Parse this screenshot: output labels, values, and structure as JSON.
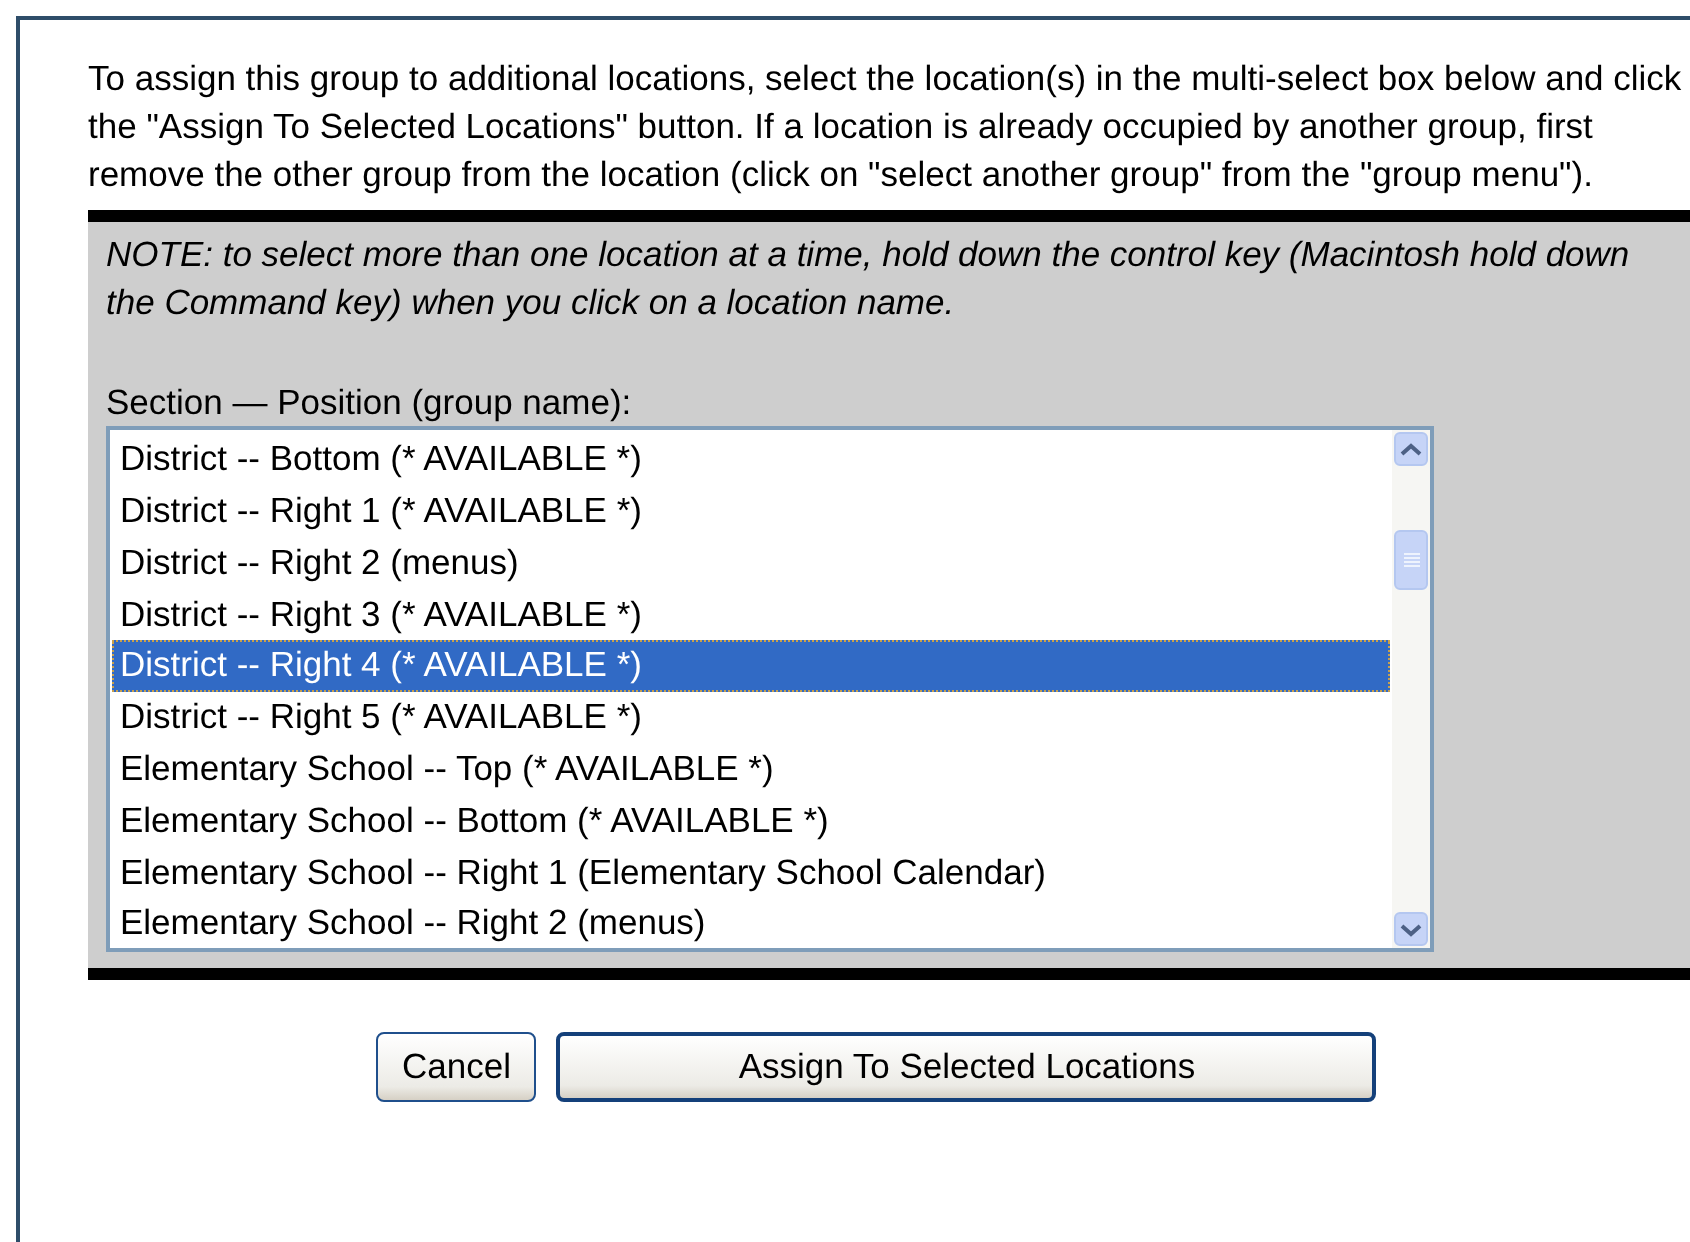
{
  "instructions": "To assign this group to additional locations, select the location(s) in the multi-select box below and click the \"Assign To Selected Locations\" button. If a location is already occupied by another group, first remove the other group from the location (click on \"select another group\" from the \"group menu\").",
  "note": "NOTE: to select more than one location at a time, hold down the control key (Macintosh hold down the Command key) when you click on a location name.",
  "list_label": "Section — Position (group name):",
  "locations": [
    {
      "label": "District -- Bottom (* AVAILABLE *)",
      "selected": false
    },
    {
      "label": "District -- Right 1 (* AVAILABLE *)",
      "selected": false
    },
    {
      "label": "District -- Right 2 (menus)",
      "selected": false
    },
    {
      "label": "District -- Right 3 (* AVAILABLE *)",
      "selected": false
    },
    {
      "label": "District -- Right 4 (* AVAILABLE *)",
      "selected": true
    },
    {
      "label": "District -- Right 5 (* AVAILABLE *)",
      "selected": false
    },
    {
      "label": "Elementary School -- Top (* AVAILABLE *)",
      "selected": false
    },
    {
      "label": "Elementary School -- Bottom (* AVAILABLE *)",
      "selected": false
    },
    {
      "label": "Elementary School -- Right 1 (Elementary School Calendar)",
      "selected": false
    },
    {
      "label": "Elementary School -- Right 2 (menus)",
      "selected": false
    }
  ],
  "buttons": [
    {
      "label": "Cancel",
      "default": false
    },
    {
      "label": "Assign To Selected Locations",
      "default": true
    }
  ]
}
